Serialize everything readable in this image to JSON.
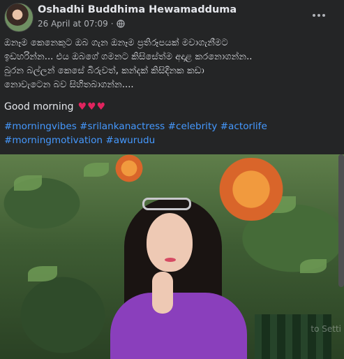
{
  "post": {
    "author": "Oshadhi Buddhima Hewamadduma",
    "timestamp": "26 April at 07:09",
    "separator": "·",
    "audience_icon": "globe-icon",
    "text_lines": [
      "ඔනෑම කෙනෙකුට ඔබ ගැන ඔනෑම ප්‍රතිරූපයක් මවාගැනීමට",
      "ඉඩහරින්න... එය ඔබගේ ගමනට කිසිසේත්ම අදාළ කරනොගන්න..",
      "බුරන බල්ලන් කෙසේ බිරුවත්, කන්දක් කිසිදිනක කඩා",
      "නොවැටෙන බව සිහිතබාගන්න...."
    ],
    "greeting": "Good morning",
    "hearts": "♥♥♥",
    "hashtags": [
      "#morningvibes",
      "#srilankanactress",
      "#celebrity",
      "#actorlife",
      "#morningmotivation",
      "#awurudu"
    ],
    "photo_watermark": "to Setti"
  },
  "colors": {
    "background": "#242526",
    "text": "#e4e6eb",
    "secondary_text": "#b0b3b8",
    "link": "#4599ff",
    "heart": "#e0245e"
  }
}
